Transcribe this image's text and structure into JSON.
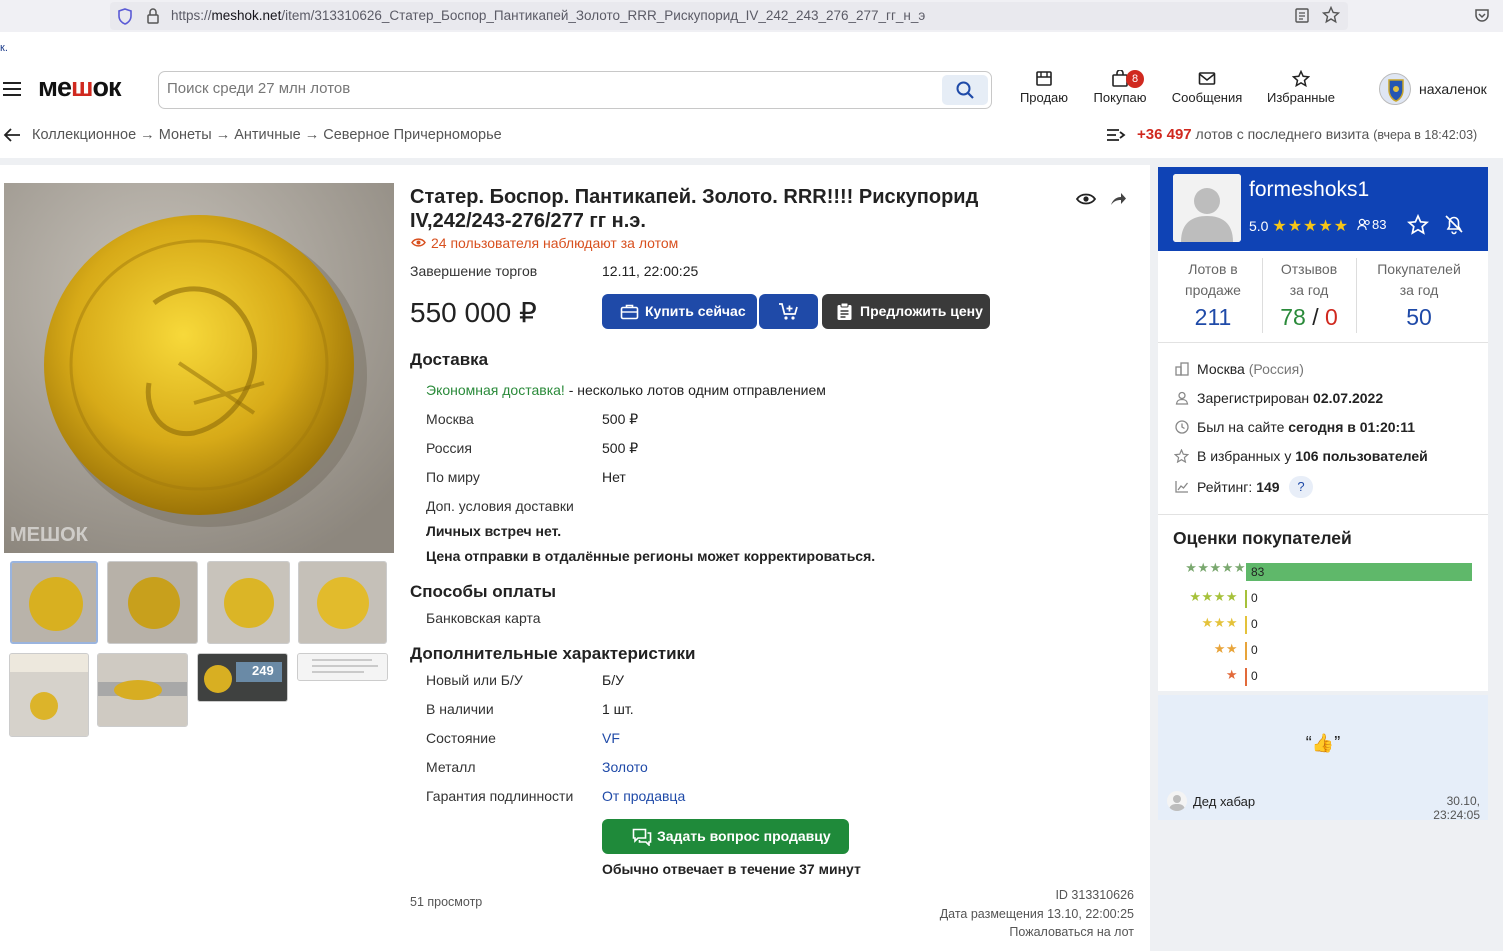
{
  "browser": {
    "url_prefix": "https://",
    "url_domain": "meshok.net",
    "url_path": "/item/313310626_Статер_Боспор_Пантикапей_Золото_RRR_Рискупорид_IV_242_243_276_277_гг_н_э",
    "stub": "к."
  },
  "header": {
    "logo_a": "ме",
    "logo_b": "ш",
    "logo_c": "ок",
    "search_placeholder": "Поиск среди 27 млн лотов",
    "nav": {
      "sell": "Продаю",
      "buy": "Покупаю",
      "buy_badge": "8",
      "messages": "Сообщения",
      "favorites": "Избранные"
    },
    "user": "нахаленок"
  },
  "breadcrumb": {
    "items": [
      "Коллекционное",
      "Монеты",
      "Античные",
      "Северное Причерноморье"
    ],
    "sep": "→",
    "new_lots": "+36 497",
    "new_lots_text": "лотов с последнего визита",
    "last_visit": "(вчера в 18:42:03)"
  },
  "lot": {
    "title_1": "Статер. Боспор. Пантикапей. Золото. RRR!!!! Рискупорид",
    "title_2": "IV,242/243-276/277 гг н.э.",
    "watchers": "24 пользователя наблюдают за лотом",
    "end_label": "Завершение торгов",
    "end_value": "12.11, 22:00:25",
    "price": "550 000 ₽",
    "buy_now": "Купить сейчас",
    "offer": "Предложить цену",
    "watermark": "МЕШОК",
    "delivery_title": "Доставка",
    "eco": "Экономная доставка!",
    "eco_text": " - несколько лотов одним отправлением",
    "delivery": [
      {
        "k": "Москва",
        "v": "500 ₽"
      },
      {
        "k": "Россия",
        "v": "500 ₽"
      },
      {
        "k": "По миру",
        "v": "Нет"
      }
    ],
    "extra_delivery_label": "Доп. условия доставки",
    "extra_1": "Личных встреч нет.",
    "extra_2": "Цена отправки в отдалённые регионы может корректироваться.",
    "payment_title": "Способы оплаты",
    "payment": "Банковская карта",
    "specs_title": "Дополнительные характеристики",
    "specs": [
      {
        "k": "Новый или Б/У",
        "v": "Б/У"
      },
      {
        "k": "В наличии",
        "v": "1 шт."
      },
      {
        "k": "Состояние",
        "v": "VF"
      },
      {
        "k": "Металл",
        "v": "Золото"
      },
      {
        "k": "Гарантия подлинности",
        "v": "От продавца"
      }
    ],
    "ask": "Задать вопрос продавцу",
    "reply": "Обычно отвечает в течение 37 минут",
    "views": "51 просмотр",
    "id": "ID 313310626",
    "posted": "Дата размещения 13.10, 22:00:25",
    "report": "Пожаловаться на лот",
    "scale_text": "249"
  },
  "seller": {
    "name": "formeshoks1",
    "rating": "5.0",
    "stars": "★★★★★",
    "reviews_icon_count": "83",
    "stats": [
      {
        "l1": "Лотов в",
        "l2": "продаже",
        "v": "211"
      },
      {
        "l1": "Отзывов",
        "l2": "за год",
        "v_pos": "78",
        "v_sep": " / ",
        "v_neg": "0"
      },
      {
        "l1": "Покупателей",
        "l2": "за год",
        "v": "50"
      }
    ],
    "city": "Москва",
    "country": "(Россия)",
    "reg_label": "Зарегистрирован",
    "reg": "02.07.2022",
    "seen_label": "Был на сайте",
    "seen": "сегодня в 01:20:11",
    "fav_label": "В избранных у",
    "fav": "106 пользователей",
    "rating_label": "Рейтинг:",
    "rating_val": "149",
    "q": "?",
    "ratings_title": "Оценки покупателей",
    "ratings": [
      {
        "stars": "★★★★★",
        "count": "83",
        "fill": 1.0
      },
      {
        "stars": "★★★★",
        "count": "0",
        "fill": 0
      },
      {
        "stars": "★★★",
        "count": "0",
        "fill": 0
      },
      {
        "stars": "★★",
        "count": "0",
        "fill": 0
      },
      {
        "stars": "★",
        "count": "0",
        "fill": 0
      }
    ],
    "review_text": "“👍”",
    "reviewer": "Дед хабар",
    "review_date": "30.10, 23:24:05"
  },
  "colors": {
    "brand_blue": "#1f4aa8",
    "seller_blue": "#0f43b5",
    "red": "#d0291f",
    "green": "#2a8a3a",
    "gold": "#d4a820"
  }
}
